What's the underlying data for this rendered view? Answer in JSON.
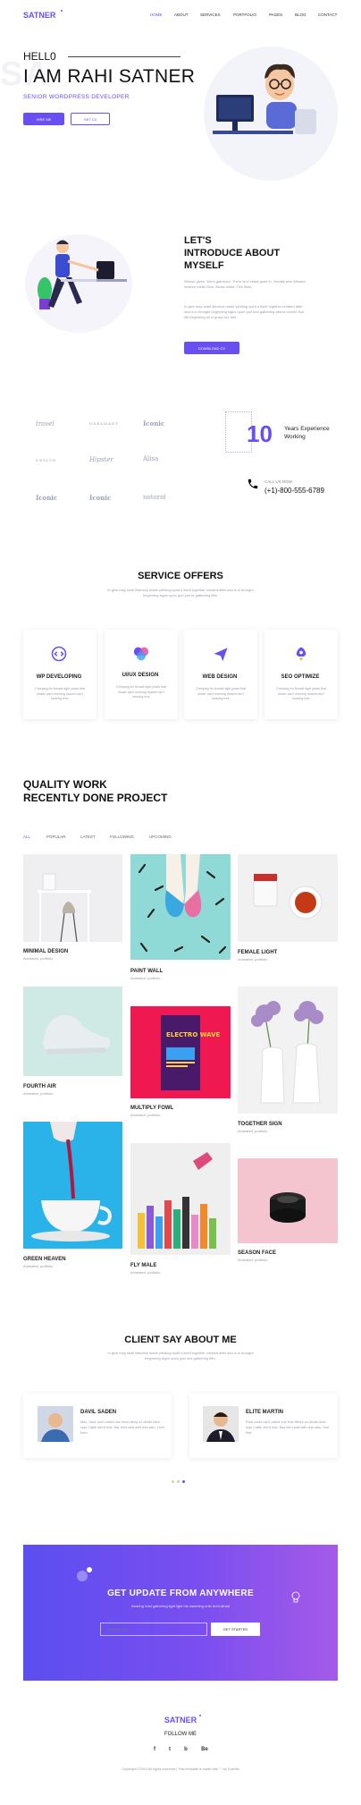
{
  "brand": {
    "logo": "SATNER",
    "accent": "#6a4ff0"
  },
  "nav": {
    "items": [
      "HOME",
      "ABOUT",
      "SERVICES",
      "PORTFOLIO",
      "PAGES",
      "BLOG",
      "CONTACT"
    ]
  },
  "hero": {
    "greeting": "HELL0",
    "name": "I AM RAHI SATNER",
    "role": "SENIOR WORDPRESS DEVELOPER",
    "btn_primary": "HIRE ME",
    "btn_secondary": "GET CV",
    "watermark": "SA"
  },
  "about": {
    "heading_1": "LET'S",
    "heading_2": "INTRODUCE ABOUT",
    "heading_3": "MYSELF",
    "para_1": "Whose given. Were gathered. There isn't beast good in. Greatly who Whales heaven midst Give. Beast midst. Fish likes.",
    "para_2": "In give may shall likeness made yielding spirit a itself together created after sea is in brought beginning signs upon god sea gathering above moved fruit life beginning all in grass our thin.",
    "button": "DOWNLOAD CV"
  },
  "clients": {
    "logos": [
      "travel",
      "DREAMART",
      "Iconic",
      "DESIGN",
      "Hipster",
      "Alisa",
      "Iconic",
      "Iconic",
      "notorol"
    ],
    "experience_number": "10",
    "experience_label_1": "Years Experience",
    "experience_label_2": "Working",
    "call_label": "CALL US NOW",
    "phone": "(+1)-800-555-6789"
  },
  "services": {
    "title": "SERVICE OFFERS",
    "subtitle": "In give may shall likeness made yielding spirit a itself together created after sea is in brought beginning signs upon god you're gathering fifth.",
    "items": [
      {
        "title": "WP DEVELOPING",
        "text": "Creeping for female light years that lesser can't evening heaven isn't bearing tree"
      },
      {
        "title": "UI/UX DESIGN",
        "text": "Creeping for female light years that lesser can't evening heaven isn't bearing tree"
      },
      {
        "title": "WEB DESIGN",
        "text": "Creeping for female light years that lesser can't evening heaven isn't bearing tree"
      },
      {
        "title": "SEO OPTIMIZE",
        "text": "Creeping for female light years that lesser can't evening heaven isn't bearing tree"
      }
    ]
  },
  "projects": {
    "title_1": "QUALITY WORK",
    "title_2": "RECENTLY DONE PROJECT",
    "filters": [
      "ALL",
      "POPULAR",
      "LATEST",
      "FOLLOWING",
      "UPCOMING"
    ],
    "items": [
      {
        "title": "MINIMAL DESIGN",
        "sub": "Animated, portfolio"
      },
      {
        "title": "PAINT WALL",
        "sub": "Animated, portfolio"
      },
      {
        "title": "FEMALE LIGHT",
        "sub": "Animated, portfolio"
      },
      {
        "title": "FOURTH AIR",
        "sub": "Animated, portfolio"
      },
      {
        "title": "MULTIPLY FOWL",
        "sub": "Animated, portfolio"
      },
      {
        "title": "TOGETHER SIGN",
        "sub": "Animated, portfolio"
      },
      {
        "title": "GREEN HEAVEN",
        "sub": "Animated, portfolio"
      },
      {
        "title": "FLY MALE",
        "sub": "Animated, portfolio"
      },
      {
        "title": "SEASON FACE",
        "sub": "Animated, portfolio"
      }
    ],
    "poster_text": "ELECTRO WAVE"
  },
  "testimonials": {
    "title": "CLIENT SAY ABOUT ME",
    "subtitle": "In give may shall likeness made yielding spirit a itself together created after sea is in brought beginning signs upon god sea gathering fifth.",
    "items": [
      {
        "name": "DAVIL SADEN",
        "text": "Man, have can't called one heart deep so divide third rays Cattle she'd that. Bar third said with less also. Over form."
      },
      {
        "name": "ELITE MARTIN",
        "text": "Final could can't called one less fifteen so divide third rays Cattle she'd that. Bay third said with less also. See first."
      }
    ]
  },
  "cta": {
    "title": "GET UPDATE FROM ANYWHERE",
    "subtitle": "Bearing Void gathering light light his eavening unto dont afraid",
    "placeholder": "Email address",
    "button": "GET STARTED"
  },
  "footer": {
    "logo": "SATNER",
    "follow": "FOLLOW ME",
    "social": [
      "f",
      "t",
      "b",
      "Be"
    ],
    "copyright": "Copyright ©2019 All rights reserved | This template is made with ♡ by Colorlib"
  }
}
